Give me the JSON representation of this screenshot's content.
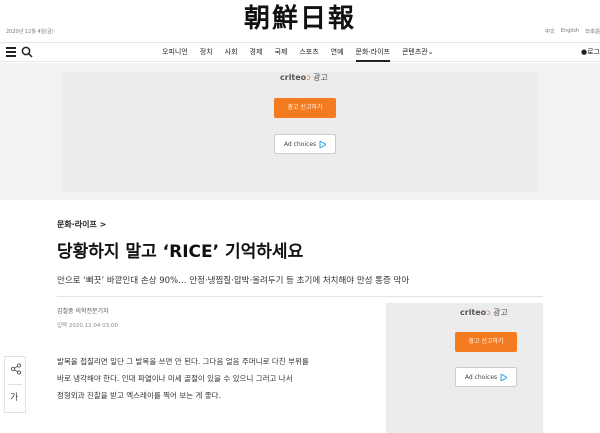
{
  "header": {
    "date": "2020년 12월 4일(금)",
    "masthead": "朝鮮日報",
    "lang_links": [
      "中文",
      "English",
      "日本語"
    ]
  },
  "nav": {
    "items": [
      {
        "label": "오피니언"
      },
      {
        "label": "정치"
      },
      {
        "label": "사회"
      },
      {
        "label": "경제"
      },
      {
        "label": "국제"
      },
      {
        "label": "스포츠"
      },
      {
        "label": "연예"
      },
      {
        "label": "문화·라이프",
        "active": true
      },
      {
        "label": "콘텐츠관"
      }
    ],
    "login": "로그"
  },
  "ad": {
    "criteo_logo": "criteo",
    "ad_label": "광고",
    "report_button": "광고 신고하기",
    "adchoices": "Ad choices"
  },
  "article": {
    "section": "문화·라이프 >",
    "headline": "당황하지 말고 ‘RICE’ 기억하세요",
    "subhead": "안으로 ‘삐끗’ 바깥인대 손상 90%… 안정·냉찜질·압박·올려두기 등 초기에 처치해야 만성 통증 막아",
    "byline": "김철중 의학전문기자",
    "pubdate": "입력 2020.12.04 03:00",
    "paragraphs": [
      "발목을 접질리면 일단 그 발목을 쓰면 안 된다. 그다음 얼음 주머니로 다친 부위를",
      "바로 냉각해야 한다. 인대 파열이나 미세 골절이 있을 수 있으니 그러고 나서",
      "정형외과 진찰을 받고 엑스레이를 찍어 보는 게 좋다."
    ]
  },
  "side_ad": {
    "criteo_logo": "criteo",
    "ad_label": "광고",
    "report_button": "광고 신고하기",
    "adchoices": "Ad choices"
  },
  "sidebar": {
    "font_label": "가"
  },
  "colors": {
    "accent": "#f47b20",
    "ad_background": "#ececec"
  }
}
